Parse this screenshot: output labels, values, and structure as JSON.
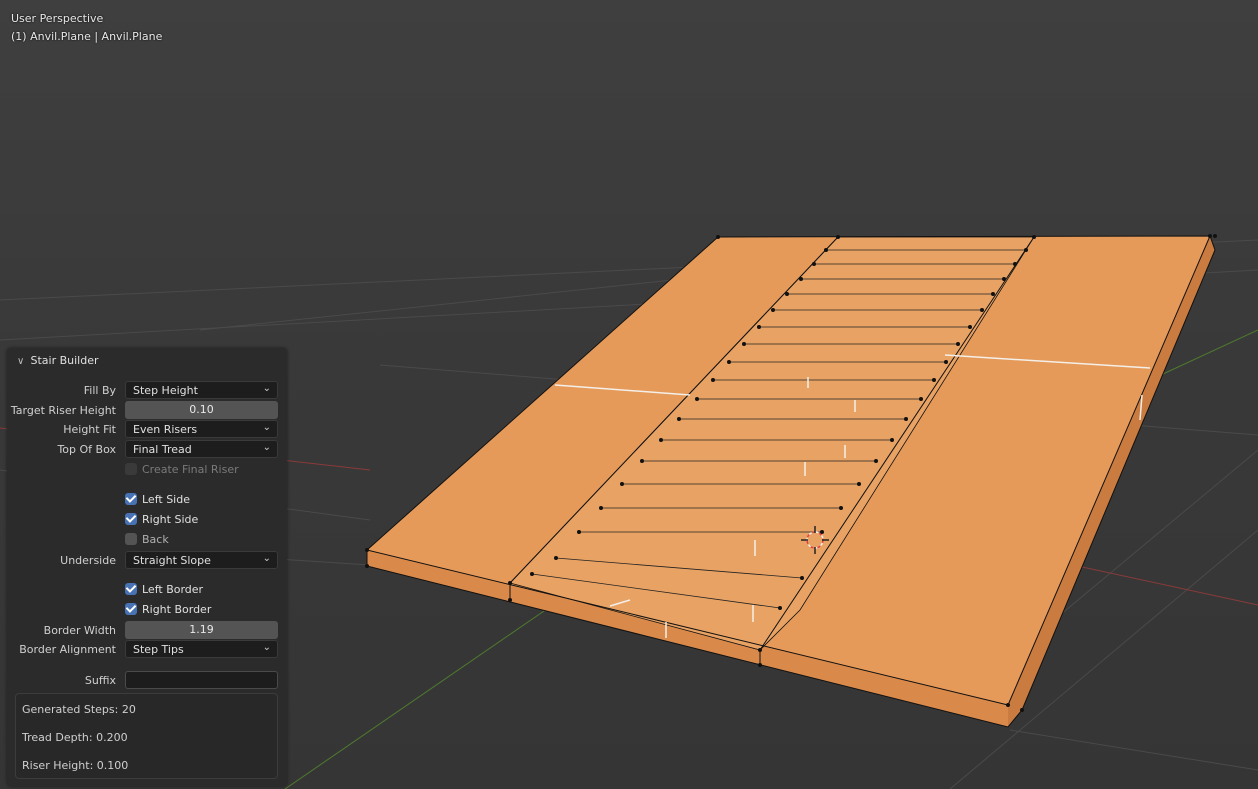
{
  "viewport": {
    "perspective_label": "User Perspective",
    "object_label": "(1) Anvil.Plane | Anvil.Plane",
    "mesh_color": "#e59a5a"
  },
  "panel": {
    "title": "Stair Builder",
    "fill_by": {
      "label": "Fill By",
      "value": "Step Height"
    },
    "target_riser_height": {
      "label": "Target Riser Height",
      "value": "0.10"
    },
    "height_fit": {
      "label": "Height Fit",
      "value": "Even Risers"
    },
    "top_of_box": {
      "label": "Top Of Box",
      "value": "Final Tread"
    },
    "create_final_riser": {
      "label": "Create Final Riser",
      "checked": false,
      "disabled": true
    },
    "left_side": {
      "label": "Left Side",
      "checked": true
    },
    "right_side": {
      "label": "Right Side",
      "checked": true
    },
    "back": {
      "label": "Back",
      "checked": false
    },
    "underside": {
      "label": "Underside",
      "value": "Straight Slope"
    },
    "left_border": {
      "label": "Left Border",
      "checked": true
    },
    "right_border": {
      "label": "Right Border",
      "checked": true
    },
    "border_width": {
      "label": "Border Width",
      "value": "1.19"
    },
    "border_alignment": {
      "label": "Border Alignment",
      "value": "Step Tips"
    },
    "suffix": {
      "label": "Suffix",
      "value": ""
    },
    "info": {
      "generated_steps": "Generated Steps: 20",
      "tread_depth": "Tread Depth: 0.200",
      "riser_height": "Riser Height: 0.100"
    }
  }
}
